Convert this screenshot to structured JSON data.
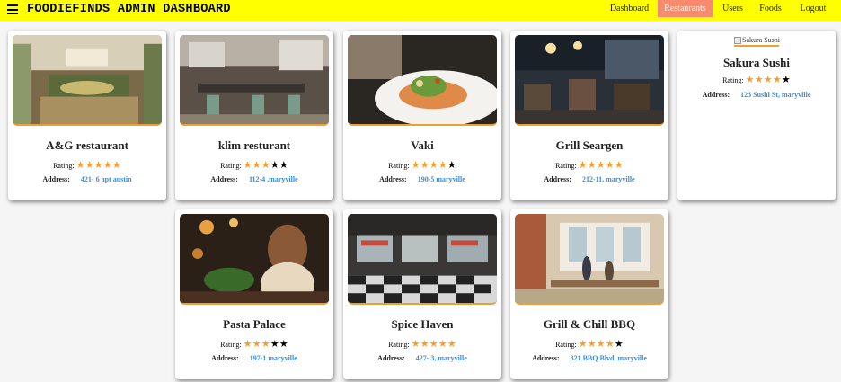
{
  "header": {
    "title": "FOODIEFINDS ADMIN DASHBOARD",
    "nav": [
      {
        "label": "Dashboard",
        "active": false
      },
      {
        "label": "Restaurants",
        "active": true
      },
      {
        "label": "Users",
        "active": false
      },
      {
        "label": "Foods",
        "active": false
      },
      {
        "label": "Logout",
        "active": false
      }
    ]
  },
  "rating_label": "Rating:",
  "address_label": "Address:",
  "restaurants": [
    {
      "name": "A&G restaurant",
      "rating": 5,
      "address": "421- 6 apt austin",
      "image_alt": ""
    },
    {
      "name": "klim resturant",
      "rating": 3,
      "address": "112-4 ,maryville",
      "image_alt": ""
    },
    {
      "name": "Vaki",
      "rating": 4,
      "address": "190-5 maryville",
      "image_alt": ""
    },
    {
      "name": "Grill Seargen",
      "rating": 5,
      "address": "212-11, maryville",
      "image_alt": ""
    },
    {
      "name": "Sakura Sushi",
      "rating": 4,
      "address": "123 Sushi St, maryville",
      "image_alt": "Sakura Sushi"
    },
    {
      "name": "Pasta Palace",
      "rating": 3,
      "address": "197-1 maryville",
      "image_alt": ""
    },
    {
      "name": "Spice Haven",
      "rating": 5,
      "address": "427- 3, maryville",
      "image_alt": ""
    },
    {
      "name": "Grill & Chill BBQ",
      "rating": 4,
      "address": "321 BBQ Blvd, maryville",
      "image_alt": ""
    }
  ],
  "colors": {
    "header_bg": "#ffff00",
    "active_nav": "#f88a6e",
    "star": "#f0a030",
    "address": "#3b8ed8"
  }
}
